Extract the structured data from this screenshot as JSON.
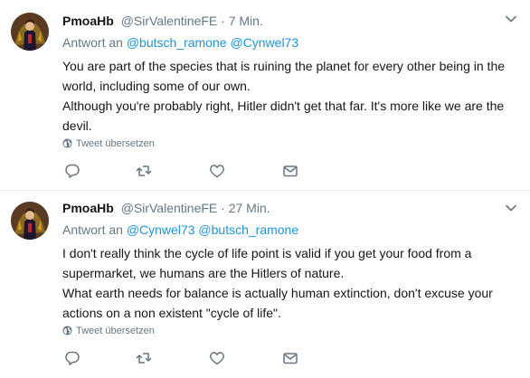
{
  "tweets": [
    {
      "user_name": "PmoaHb",
      "handle": "@SirValentineFE",
      "dot": "·",
      "time": "7 Min.",
      "reply_prefix": "Antwort an",
      "mentions": [
        "@butsch_ramone",
        "@Cynwel73"
      ],
      "paragraphs": [
        "You are part of the species that is ruining the planet for every other being in the world, including some of our own.",
        "Although you're probably right, Hitler didn't get that far. It's more like we are the devil."
      ],
      "translate_label": "Tweet übersetzen"
    },
    {
      "user_name": "PmoaHb",
      "handle": "@SirValentineFE",
      "dot": "·",
      "time": "27 Min.",
      "reply_prefix": "Antwort an",
      "mentions": [
        "@Cynwel73",
        "@butsch_ramone"
      ],
      "paragraphs": [
        "I don't really think the cycle of life point is valid if you get your food from a supermarket, we humans are the Hitlers of nature.",
        "What earth needs for balance is actually human extinction, don't excuse your actions on a non existent \"cycle of life\"."
      ],
      "translate_label": "Tweet übersetzen"
    }
  ],
  "colors": {
    "text": "#14171a",
    "secondary": "#657786",
    "link": "#1b95e0",
    "divider": "#e6ecf0"
  },
  "icons": [
    "chevron-down-icon",
    "globe-icon",
    "reply-icon",
    "retweet-icon",
    "like-icon",
    "message-icon"
  ]
}
